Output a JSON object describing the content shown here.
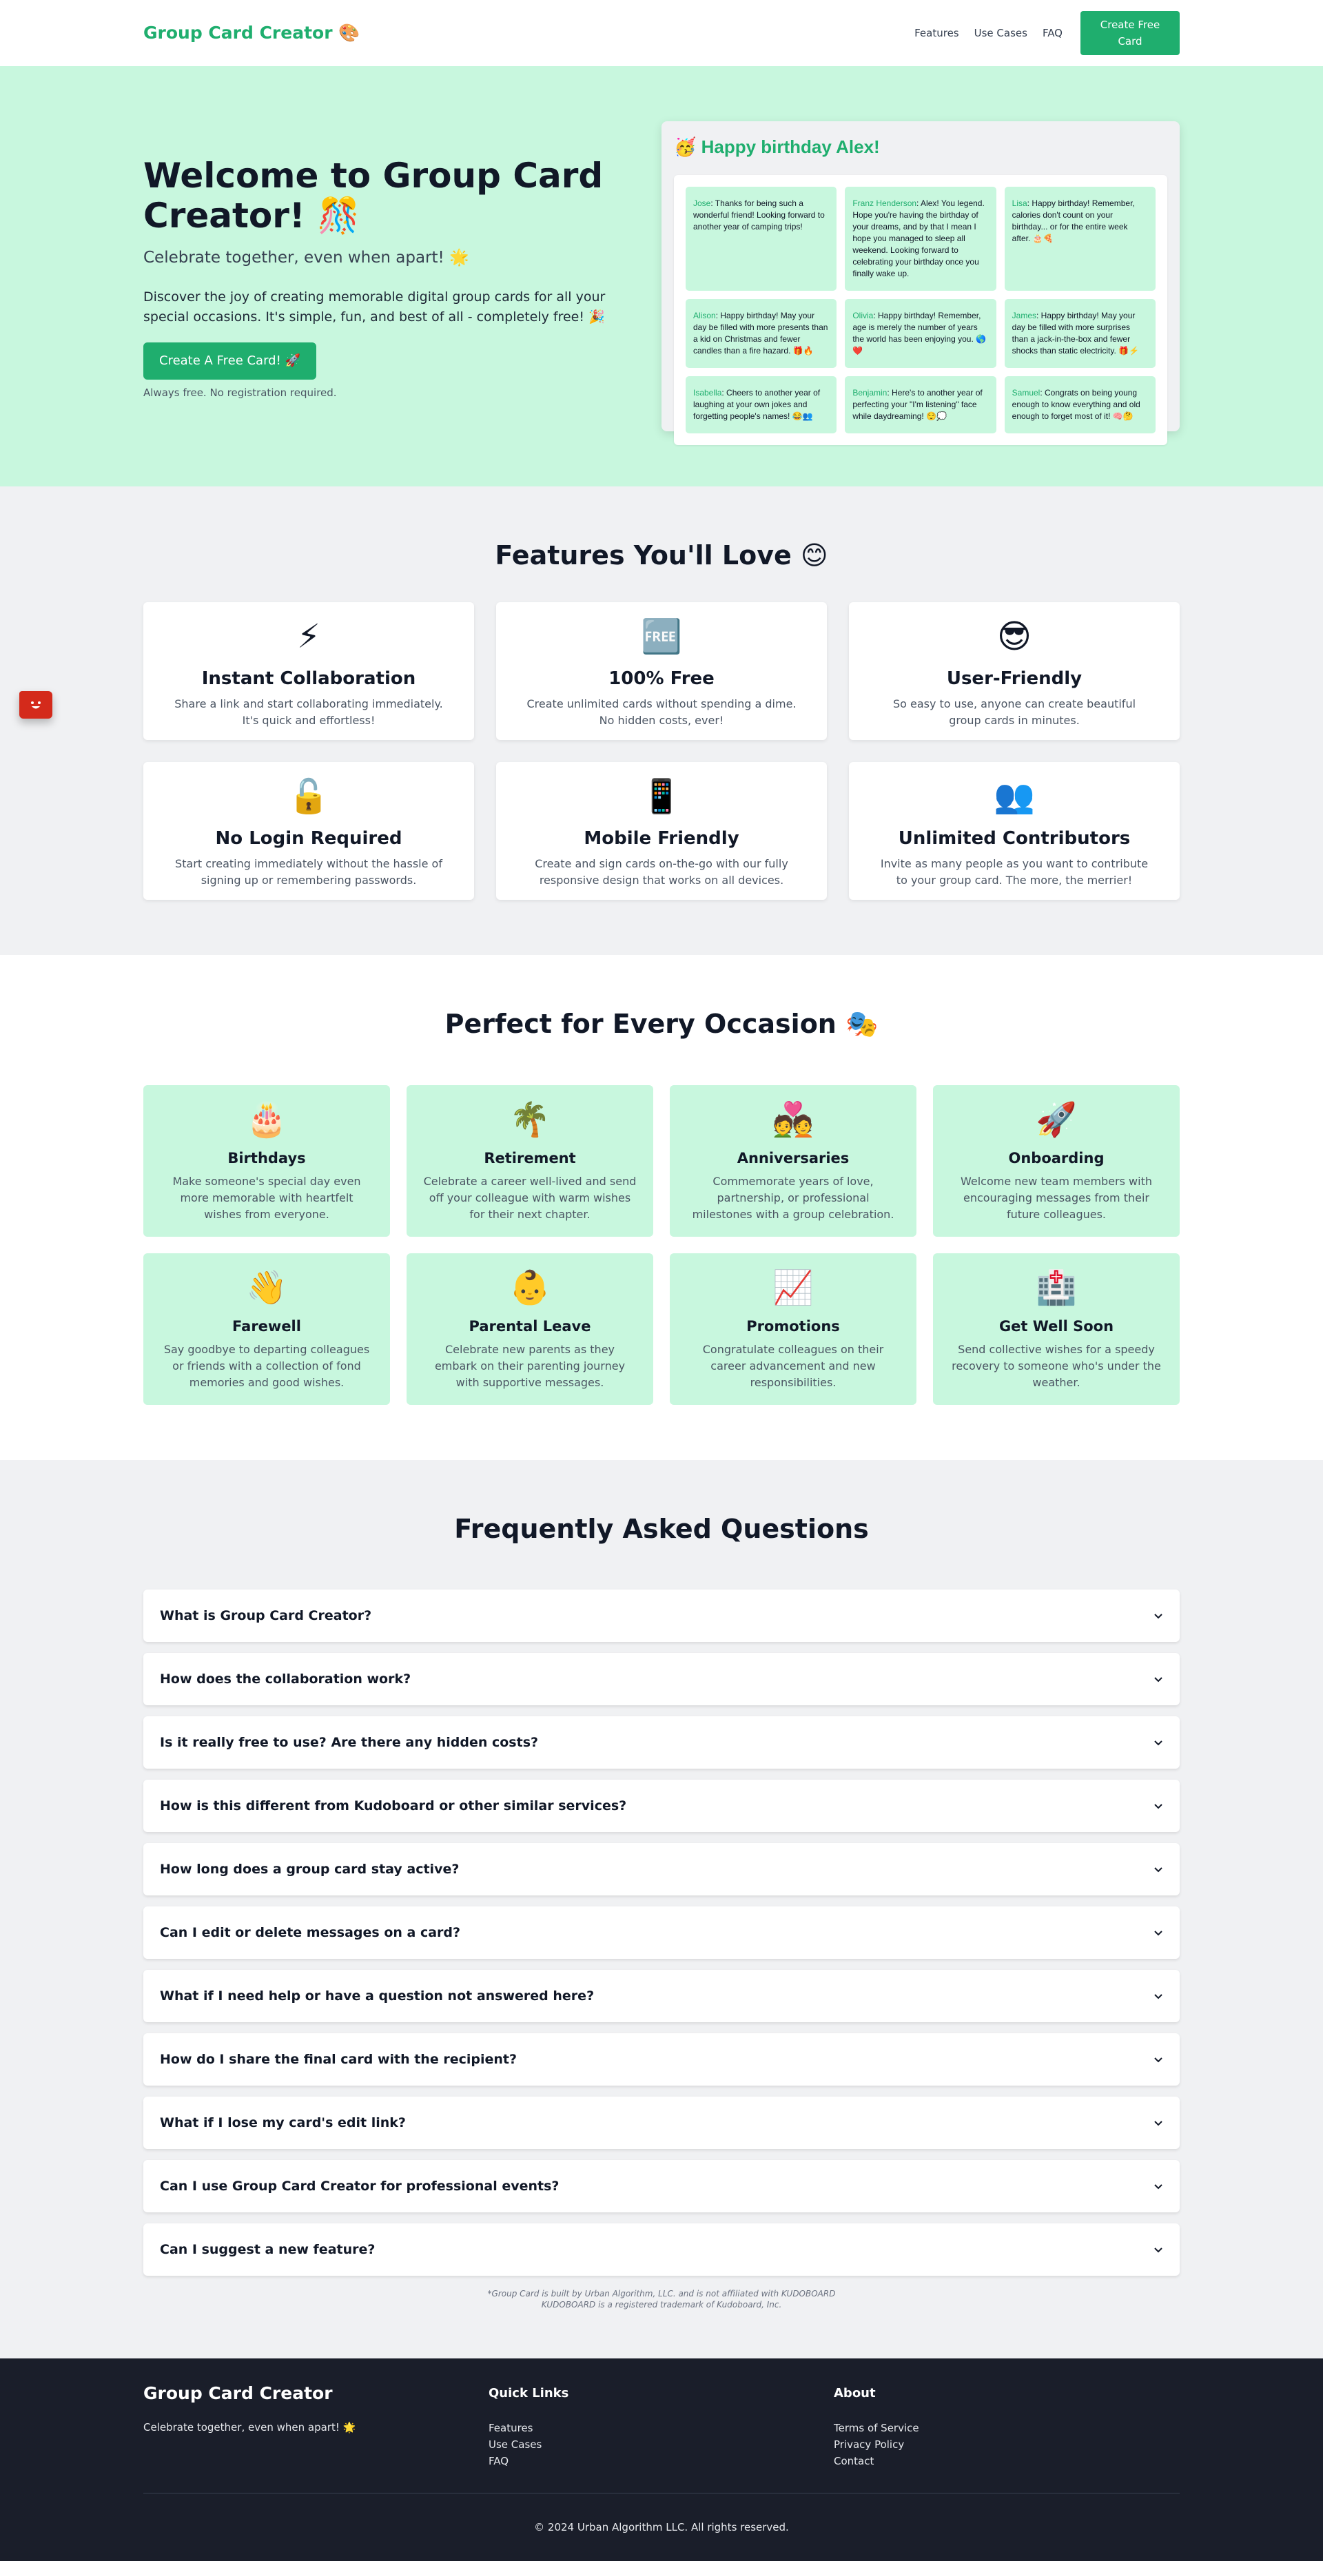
{
  "header": {
    "logo": "Group Card Creator 🎨",
    "nav": [
      "Features",
      "Use Cases",
      "FAQ"
    ],
    "cta": "Create Free Card"
  },
  "hero": {
    "title": "Welcome to Group Card Creator! 🎊",
    "subtitle": "Celebrate together, even when apart! 🌟",
    "description": "Discover the joy of creating memorable digital group cards for all your special occasions. It's simple, fun, and best of all - completely free! 🎉",
    "button": "Create A Free Card! 🚀",
    "note": "Always free. No registration required.",
    "preview": {
      "title": "🥳 Happy birthday Alex!",
      "messages": [
        {
          "author": "Jose",
          "text": ": Thanks for being such a wonderful friend! Looking forward to another year of camping trips!"
        },
        {
          "author": "Franz Henderson",
          "text": ": Alex! You legend. Hope you're having the birthday of your dreams, and by that I mean I hope you managed to sleep all weekend. Looking forward to celebrating your birthday once you finally wake up."
        },
        {
          "author": "Lisa",
          "text": ": Happy birthday! Remember, calories don't count on your birthday... or for the entire week after. 🎂🍕"
        },
        {
          "author": "Alison",
          "text": ": Happy birthday! May your day be filled with more presents than a kid on Christmas and fewer candles than a fire hazard. 🎁🔥"
        },
        {
          "author": "Olivia",
          "text": ": Happy birthday! Remember, age is merely the number of years the world has been enjoying you. 🌎❤️"
        },
        {
          "author": "James",
          "text": ": Happy birthday! May your day be filled with more surprises than a jack-in-the-box and fewer shocks than static electricity. 🎁⚡"
        },
        {
          "author": "Isabella",
          "text": ": Cheers to another year of laughing at your own jokes and forgetting people's names! 😂👥"
        },
        {
          "author": "Benjamin",
          "text": ": Here's to another year of perfecting your \"I'm listening\" face while daydreaming! 😌💭"
        },
        {
          "author": "Samuel",
          "text": ": Congrats on being young enough to know everything and old enough to forget most of it! 🧠🤔"
        }
      ]
    }
  },
  "features": {
    "title": "Features You'll Love 😊",
    "items": [
      {
        "icon": "⚡",
        "icon_name": "lightning-icon",
        "title": "Instant Collaboration",
        "desc": "Share a link and start collaborating immediately. It's quick and effortless!"
      },
      {
        "icon": "🆓",
        "icon_name": "free-badge-icon",
        "title": "100% Free",
        "desc": "Create unlimited cards without spending a dime. No hidden costs, ever!"
      },
      {
        "icon": "😎",
        "icon_name": "sunglasses-face-icon",
        "title": "User-Friendly",
        "desc": "So easy to use, anyone can create beautiful group cards in minutes."
      },
      {
        "icon": "🔓",
        "icon_name": "unlocked-icon",
        "title": "No Login Required",
        "desc": "Start creating immediately without the hassle of signing up or remembering passwords."
      },
      {
        "icon": "📱",
        "icon_name": "mobile-phone-icon",
        "title": "Mobile Friendly",
        "desc": "Create and sign cards on-the-go with our fully responsive design that works on all devices."
      },
      {
        "icon": "👥",
        "icon_name": "people-icon",
        "title": "Unlimited Contributors",
        "desc": "Invite as many people as you want to contribute to your group card. The more, the merrier!"
      }
    ]
  },
  "occasions": {
    "title": "Perfect for Every Occasion 🎭",
    "items": [
      {
        "icon": "🎂",
        "icon_name": "birthday-cake-icon",
        "title": "Birthdays",
        "desc": "Make someone's special day even more memorable with heartfelt wishes from everyone."
      },
      {
        "icon": "🌴",
        "icon_name": "palm-tree-icon",
        "title": "Retirement",
        "desc": "Celebrate a career well-lived and send off your colleague with warm wishes for their next chapter."
      },
      {
        "icon": "💑",
        "icon_name": "couple-heart-icon",
        "title": "Anniversaries",
        "desc": "Commemorate years of love, partnership, or professional milestones with a group celebration."
      },
      {
        "icon": "🚀",
        "icon_name": "rocket-icon",
        "title": "Onboarding",
        "desc": "Welcome new team members with encouraging messages from their future colleagues."
      },
      {
        "icon": "👋",
        "icon_name": "waving-hand-icon",
        "title": "Farewell",
        "desc": "Say goodbye to departing colleagues or friends with a collection of fond memories and good wishes."
      },
      {
        "icon": "👶",
        "icon_name": "baby-icon",
        "title": "Parental Leave",
        "desc": "Celebrate new parents as they embark on their parenting journey with supportive messages."
      },
      {
        "icon": "📈",
        "icon_name": "chart-increasing-icon",
        "title": "Promotions",
        "desc": "Congratulate colleagues on their career advancement and new responsibilities."
      },
      {
        "icon": "🏥",
        "icon_name": "hospital-icon",
        "title": "Get Well Soon",
        "desc": "Send collective wishes for a speedy recovery to someone who's under the weather."
      }
    ]
  },
  "faq": {
    "title": "Frequently Asked Questions",
    "items": [
      "What is Group Card Creator?",
      "How does the collaboration work?",
      "Is it really free to use? Are there any hidden costs?",
      "How is this different from Kudoboard or other similar services?",
      "How long does a group card stay active?",
      "Can I edit or delete messages on a card?",
      "What if I need help or have a question not answered here?",
      "How do I share the final card with the recipient?",
      "What if I lose my card's edit link?",
      "Can I use Group Card Creator for professional events?",
      "Can I suggest a new feature?"
    ],
    "disclaimer_line1": "*Group Card is built by Urban Algorithm, LLC. and is not affiliated with KUDOBOARD",
    "disclaimer_line2": "KUDOBOARD is a registered trademark of Kudoboard, Inc."
  },
  "footer": {
    "brand": "Group Card Creator",
    "tagline": "Celebrate together, even when apart! 🌟",
    "quick_links_heading": "Quick Links",
    "quick_links": [
      "Features",
      "Use Cases",
      "FAQ"
    ],
    "about_heading": "About",
    "about_links": [
      "Terms of Service",
      "Privacy Policy",
      "Contact"
    ],
    "copyright": "© 2024 Urban Algorithm LLC. All rights reserved."
  },
  "colors": {
    "brand_green": "#1fae6e",
    "mint_bg": "#c8f7de",
    "footer_bg": "#1a1e2a",
    "chat_widget_red": "#d42a1b"
  }
}
